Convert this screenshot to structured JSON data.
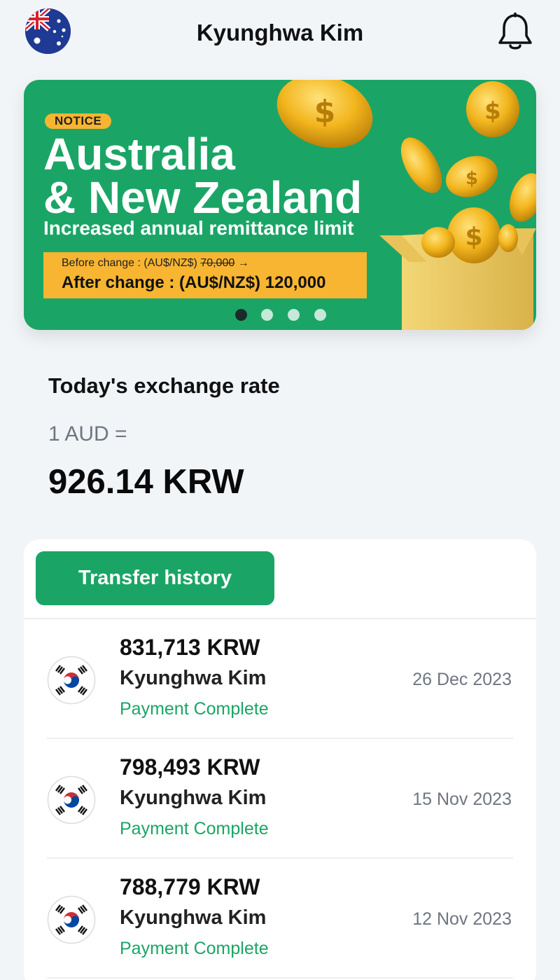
{
  "header": {
    "title": "Kyunghwa Kim",
    "left_icon": "australia-flag-icon",
    "right_icon": "bell-icon"
  },
  "banner": {
    "badge": "NOTICE",
    "title_line1": "Australia",
    "title_line2": "& New Zealand",
    "subtitle": "Increased annual remittance limit",
    "before_label": "Before change : (AU$/NZ$) ",
    "before_value": "70,000",
    "before_arrow": " →",
    "after_text": "After change : (AU$/NZ$) 120,000",
    "page_count": 4,
    "active_page": 1,
    "colors": {
      "background": "#1aa566",
      "accent": "#f7b531"
    }
  },
  "exchange": {
    "label": "Today's exchange rate",
    "base": "1 AUD =",
    "value": "926.14 KRW"
  },
  "history": {
    "button_label": "Transfer history",
    "items": [
      {
        "amount": "831,713 KRW",
        "name": "Kyunghwa Kim",
        "status": "Payment Complete",
        "date": "26 Dec 2023",
        "flag": "korea-flag-icon"
      },
      {
        "amount": "798,493 KRW",
        "name": "Kyunghwa Kim",
        "status": "Payment Complete",
        "date": "15 Nov 2023",
        "flag": "korea-flag-icon"
      },
      {
        "amount": "788,779 KRW",
        "name": "Kyunghwa Kim",
        "status": "Payment Complete",
        "date": "12 Nov 2023",
        "flag": "korea-flag-icon"
      }
    ]
  },
  "theme": {
    "primary": "#1aa566",
    "background": "#f2f5f8",
    "muted_text": "#6f7680"
  }
}
